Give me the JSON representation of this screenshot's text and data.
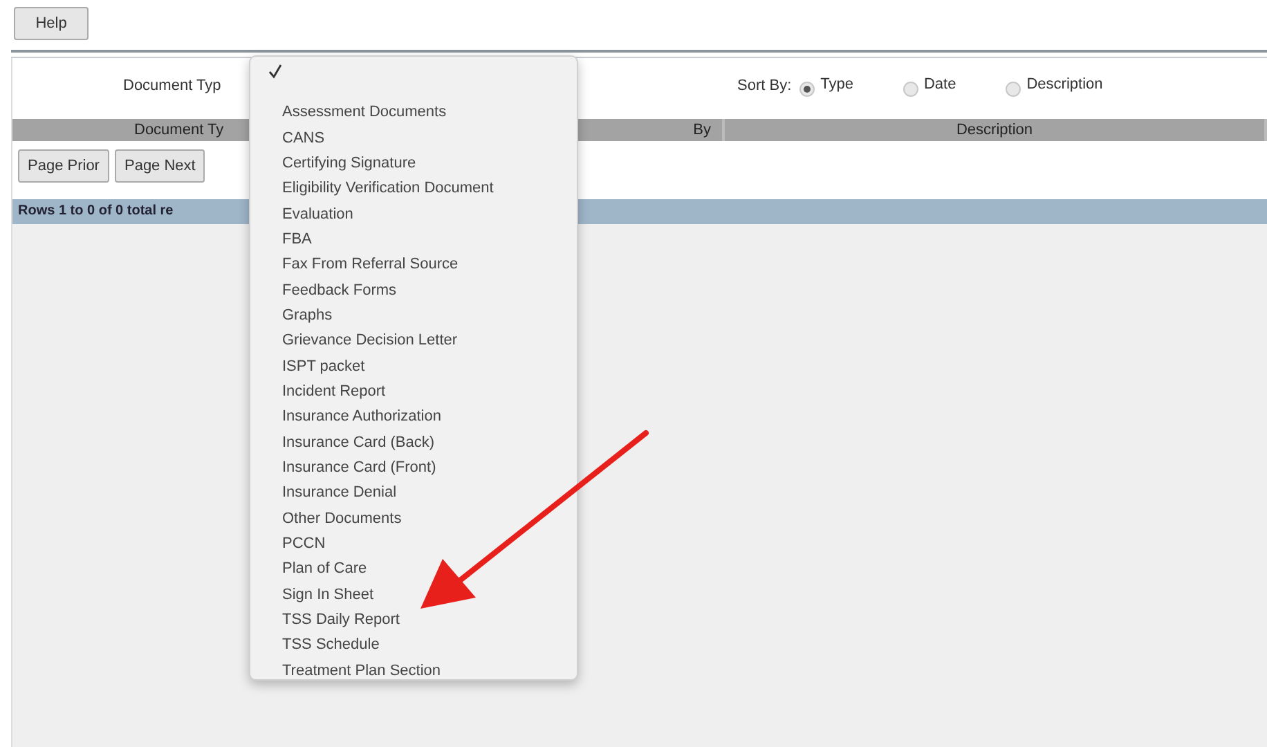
{
  "toolbar": {
    "help_button": "Help"
  },
  "filter": {
    "label": "Document Typ",
    "sort_label": "Sort By:",
    "sort_options": [
      {
        "label": "Type",
        "selected": true
      },
      {
        "label": "Date",
        "selected": false
      },
      {
        "label": "Description",
        "selected": false
      }
    ]
  },
  "table": {
    "columns": [
      "Document Ty",
      "By",
      "Description"
    ]
  },
  "pager": {
    "buttons": [
      "Page Prior",
      "Page Next"
    ]
  },
  "status_bar": "Rows 1 to 0 of 0 total re",
  "dropdown": {
    "options": [
      {
        "selected": true
      },
      {
        "label": "Assessment Documents",
        "selected": false
      },
      {
        "label": "CANS",
        "selected": false
      },
      {
        "label": "Certifying Signature",
        "selected": false
      },
      {
        "label": "Eligibility Verification Document",
        "selected": false
      },
      {
        "label": "Evaluation",
        "selected": false
      },
      {
        "label": "FBA",
        "selected": false
      },
      {
        "label": "Fax From Referral Source",
        "selected": false
      },
      {
        "label": "Feedback Forms",
        "selected": false
      },
      {
        "label": "Graphs",
        "selected": false
      },
      {
        "label": "Grievance Decision Letter",
        "selected": false
      },
      {
        "label": "ISPT packet",
        "selected": false
      },
      {
        "label": "Incident Report",
        "selected": false
      },
      {
        "label": "Insurance Authorization",
        "selected": false
      },
      {
        "label": "Insurance Card (Back)",
        "selected": false
      },
      {
        "label": "Insurance Card (Front)",
        "selected": false
      },
      {
        "label": "Insurance Denial",
        "selected": false
      },
      {
        "label": "Other Documents",
        "selected": false
      },
      {
        "label": "PCCN",
        "selected": false
      },
      {
        "label": "Plan of Care",
        "selected": false
      },
      {
        "label": "Sign In Sheet",
        "selected": false
      },
      {
        "label": "TSS Daily Report",
        "selected": false
      },
      {
        "label": "TSS Schedule",
        "selected": false
      },
      {
        "label": "Treatment Plan Section",
        "selected": false
      }
    ]
  }
}
